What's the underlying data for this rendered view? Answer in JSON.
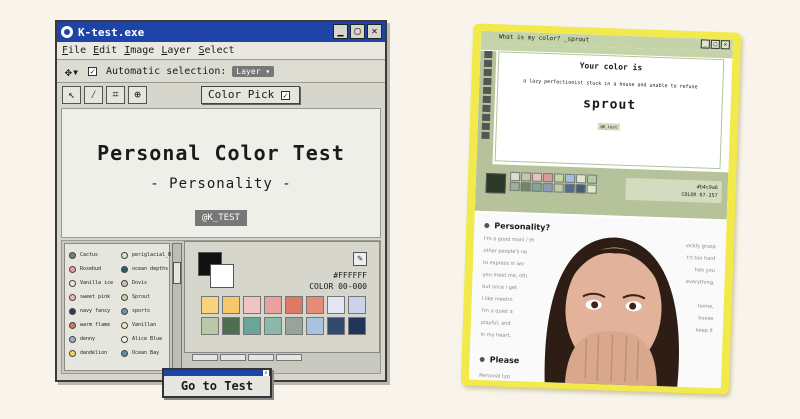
{
  "window": {
    "title": "K-test.exe",
    "buttons": [
      "▁",
      "▢",
      "✕"
    ]
  },
  "menu": [
    "File",
    "Edit",
    "Image",
    "Layer",
    "Select"
  ],
  "toolbar": {
    "auto_selection_label": "Automatic selection:",
    "layer_value": "Layer",
    "color_pick_label": "Color Pick"
  },
  "canvas": {
    "title": "Personal Color Test",
    "subtitle": "- Personality -",
    "tag": "@K_TEST"
  },
  "swatches": {
    "left": [
      {
        "name": "Cactus",
        "color": "#6b8a6b"
      },
      {
        "name": "Rosebud",
        "color": "#e8a0a8"
      },
      {
        "name": "Vanilla ice",
        "color": "#f1ebd2"
      },
      {
        "name": "sweet pink",
        "color": "#f1b3bc"
      },
      {
        "name": "navy fancy",
        "color": "#2c3a66"
      },
      {
        "name": "warm flame",
        "color": "#d9785a"
      },
      {
        "name": "denny",
        "color": "#9ab1cf"
      },
      {
        "name": "dandelion",
        "color": "#f4d35e"
      }
    ],
    "right": [
      {
        "name": "periglacial_B",
        "color": "#d7e6d3"
      },
      {
        "name": "ocean depths",
        "color": "#2f5d6b"
      },
      {
        "name": "Dovis",
        "color": "#c9c1b0"
      },
      {
        "name": "Sprout",
        "color": "#c5d6a0"
      },
      {
        "name": "sports",
        "color": "#6f8fb3"
      },
      {
        "name": "Vanillan",
        "color": "#f2e6c2"
      },
      {
        "name": "Alice Blue",
        "color": "#eef4fa"
      },
      {
        "name": "Ocean Bay",
        "color": "#5f8ea0"
      }
    ]
  },
  "palette": {
    "hex": "#FFFFFF",
    "code": "COLOR 00-000",
    "colors": [
      "#f7d57a",
      "#f5c96b",
      "#efc3c3",
      "#e8a0a0",
      "#dd7a64",
      "#e58b7a",
      "#e6e6f3",
      "#cbd2ec",
      "#b9c9a6",
      "#4e6e52",
      "#6aa59a",
      "#8cb8a9",
      "#9aa39a",
      "#a9c2dd",
      "#2e4a6e",
      "#22345c"
    ]
  },
  "goto_button": {
    "label": "Go to Test"
  },
  "phone": {
    "title": "What is my color? _sprout",
    "your_color": "Your color is",
    "desc": "a lazy perfectionist stuck in a house and unable to refuse",
    "result": "sprout",
    "tag": "@K_test",
    "hex": "#b4c9a6",
    "code": "COLOR 07-257",
    "personality_heading": "Personality?",
    "lines": [
      "I'm a good mani / th",
      "other people's ne",
      "to express in wo",
      "you meet me, oth",
      "but once i get",
      "I like meetin",
      "I'm a quiet a",
      "playful, and",
      "in my heart,"
    ],
    "lines_right": [
      "uickly grasp",
      "t's too hard",
      "hen you",
      "everything,",
      "",
      "home,",
      "hoose",
      "keep it",
      ""
    ],
    "please_heading": "Please",
    "bottom_line": "Personal typ",
    "palette_colors": [
      "#d7ddd0",
      "#c3c9a8",
      "#e8c1c1",
      "#d89a9a",
      "#c5d6a0",
      "#a7c0d8",
      "#dfe6cb",
      "#b4c9a6",
      "#9bb29a",
      "#6b8a6b",
      "#7fa69a",
      "#8aa0b2",
      "#c0c8a4",
      "#4f6d8a",
      "#3d5f7a",
      "#dfe6cb"
    ]
  }
}
